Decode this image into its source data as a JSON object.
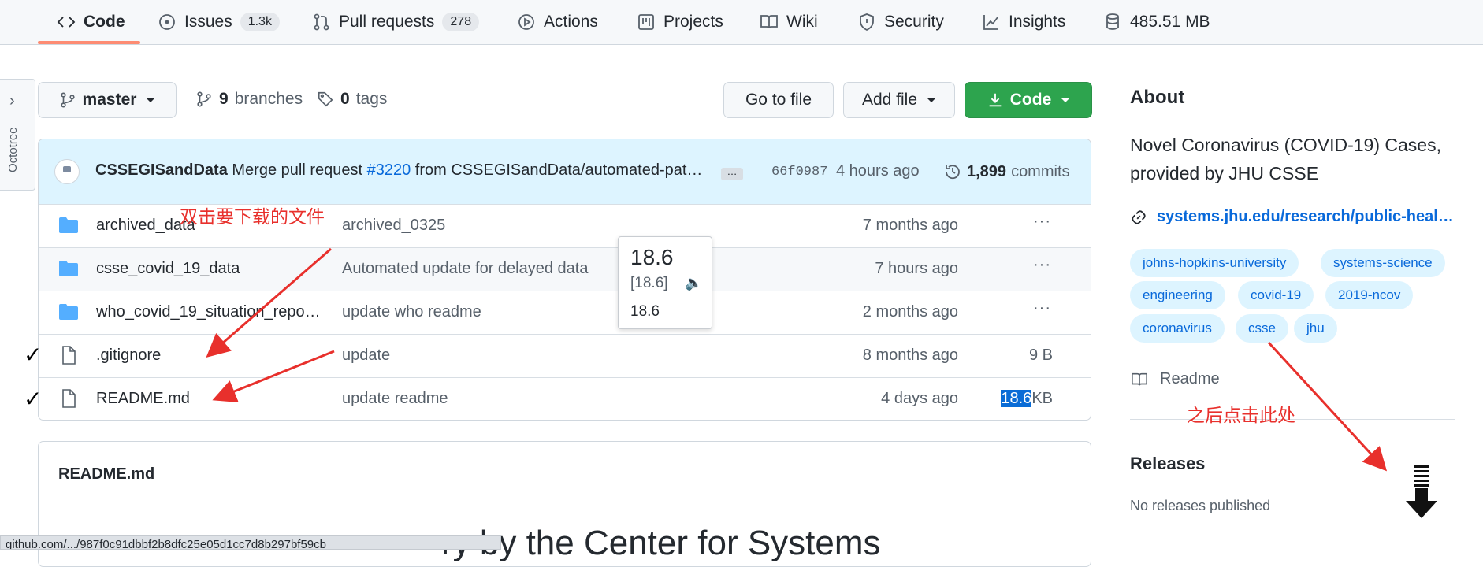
{
  "nav": {
    "tabs": [
      {
        "label": "Code",
        "icon": "code-icon"
      },
      {
        "label": "Issues",
        "count": "1.3k",
        "icon": "issue-icon"
      },
      {
        "label": "Pull requests",
        "count": "278",
        "icon": "pull-request-icon"
      },
      {
        "label": "Actions",
        "icon": "play-icon"
      },
      {
        "label": "Projects",
        "icon": "project-icon"
      },
      {
        "label": "Wiki",
        "icon": "book-icon"
      },
      {
        "label": "Security",
        "icon": "shield-icon"
      },
      {
        "label": "Insights",
        "icon": "graph-icon"
      },
      {
        "label": "485.51 MB",
        "icon": "database-icon"
      }
    ]
  },
  "octotree": {
    "label": "Octotree"
  },
  "toolbar": {
    "branch": "master",
    "branches_count": "9",
    "branches_label": "branches",
    "tags_count": "0",
    "tags_label": "tags",
    "go_to_file": "Go to file",
    "add_file": "Add file",
    "code": "Code"
  },
  "commit": {
    "author": "CSSEGISandData",
    "message_prefix": "Merge pull request",
    "pr": "#3220",
    "message_suffix": "from CSSEGISandData/automated-pat…",
    "more": "…",
    "sha": "66f0987",
    "time": "4 hours ago",
    "count": "1,899",
    "count_label": "commits"
  },
  "files": [
    {
      "type": "folder",
      "name": "archived_data",
      "message": "archived_0325",
      "age": "7 months ago",
      "size": "",
      "more": "···"
    },
    {
      "type": "folder",
      "name": "csse_covid_19_data",
      "message": "Automated update for delayed data",
      "age": "7 hours ago",
      "size": "",
      "more": "···"
    },
    {
      "type": "folder",
      "name": "who_covid_19_situation_repo…",
      "message": "update who readme",
      "age": "2 months ago",
      "size": "",
      "more": "···"
    },
    {
      "type": "file",
      "name": ".gitignore",
      "message": "update",
      "age": "8 months ago",
      "size": "9 B",
      "more": ""
    },
    {
      "type": "file",
      "name": "README.md",
      "message": "update readme",
      "age": "4 days ago",
      "size_hl": "18.6",
      "size_unit": "KB",
      "more": ""
    }
  ],
  "checkmarks": [
    "✓",
    "✓"
  ],
  "tooltip": {
    "word": "18.6",
    "phonetic": "[18.6]",
    "definition": "18.6"
  },
  "readme": {
    "header": "README.md",
    "heading_fragment": "ry by the Center for Systems"
  },
  "statusbar": {
    "url": "github.com/.../987f0c91dbbf2b8dfc25e05d1cc7d8b297bf59cb"
  },
  "about": {
    "heading": "About",
    "description": "Novel Coronavirus (COVID-19) Cases, provided by JHU CSSE",
    "link": "systems.jhu.edu/research/public-heal…",
    "topics": [
      "johns-hopkins-university",
      "systems-science",
      "engineering",
      "covid-19",
      "2019-ncov",
      "coronavirus",
      "csse",
      "jhu"
    ],
    "readme_label": "Readme",
    "releases_heading": "Releases",
    "releases_none": "No releases published"
  },
  "annotations": {
    "double_click": "双击要下载的文件",
    "then_click": "之后点击此处"
  },
  "colors": {
    "accent": "#fd8c73",
    "green": "#2da44e",
    "link": "#0969da",
    "annotation": "#e8302c",
    "highlight": "#0a6cd6"
  }
}
